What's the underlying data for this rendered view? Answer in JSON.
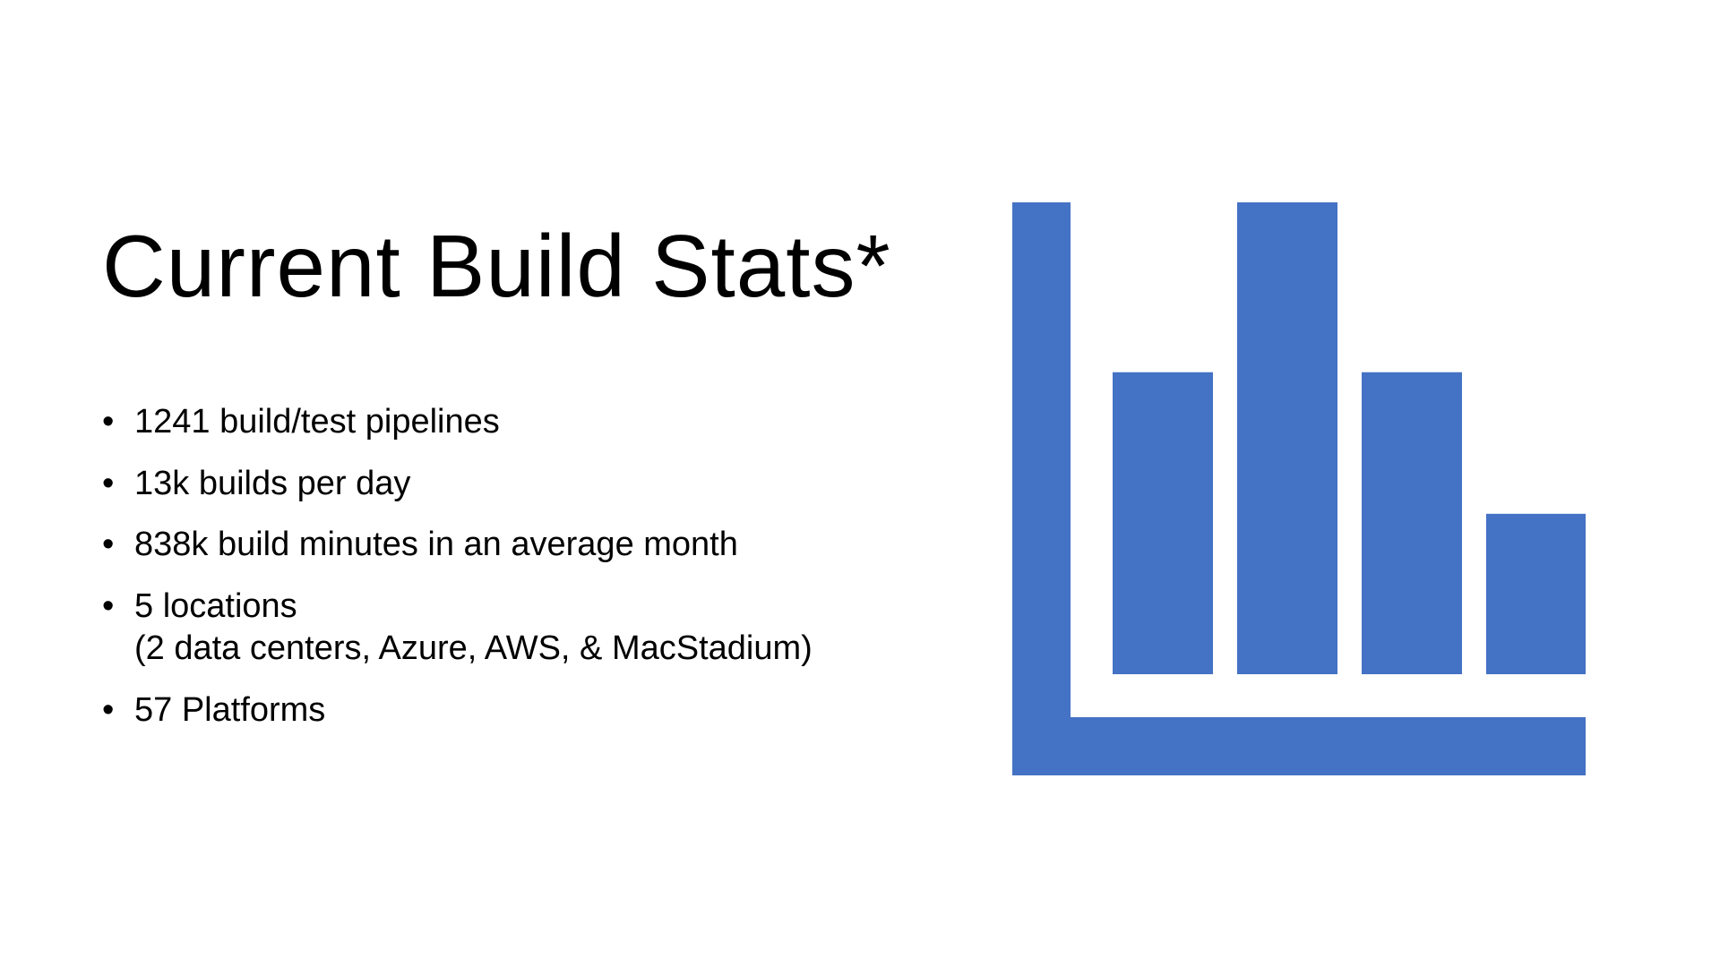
{
  "title": "Current Build Stats*",
  "bullets": [
    {
      "lines": [
        "1241 build/test pipelines"
      ]
    },
    {
      "lines": [
        "13k builds per day"
      ]
    },
    {
      "lines": [
        "838k build minutes in an average month"
      ]
    },
    {
      "lines": [
        "5 locations",
        "(2 data centers, Azure, AWS, & MacStadium)"
      ]
    },
    {
      "lines": [
        "57 Platforms"
      ]
    }
  ],
  "bullet_glyph": "•",
  "icon": {
    "name": "bar-chart-icon",
    "color": "#4472C4",
    "bar_levels": [
      0.64,
      1.0,
      0.64,
      0.34
    ]
  }
}
